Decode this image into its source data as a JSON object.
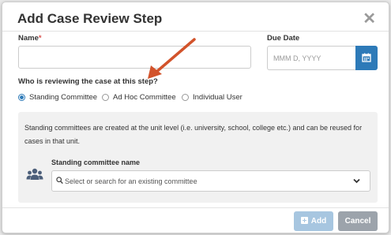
{
  "dialog": {
    "title": "Add Case Review Step"
  },
  "fields": {
    "name_label": "Name",
    "required_marker": "*",
    "due_date_label": "Due Date",
    "due_date_placeholder": "MMM D, YYYY"
  },
  "reviewers": {
    "question": "Who is reviewing the case at this step?",
    "options": [
      {
        "label": "Standing Committee",
        "selected": true
      },
      {
        "label": "Ad Hoc Committee",
        "selected": false
      },
      {
        "label": "Individual User",
        "selected": false
      }
    ]
  },
  "standing_panel": {
    "description": "Standing committees are created at the unit level (i.e. university, school, college etc.) and can be reused for cases in that unit.",
    "committee_label": "Standing committee name",
    "select_placeholder": "Select or search for an existing committee"
  },
  "footer": {
    "add_label": "Add",
    "cancel_label": "Cancel"
  },
  "colors": {
    "primary": "#2d7ab8",
    "annotation_arrow": "#d2532b",
    "required": "#d9534f"
  }
}
